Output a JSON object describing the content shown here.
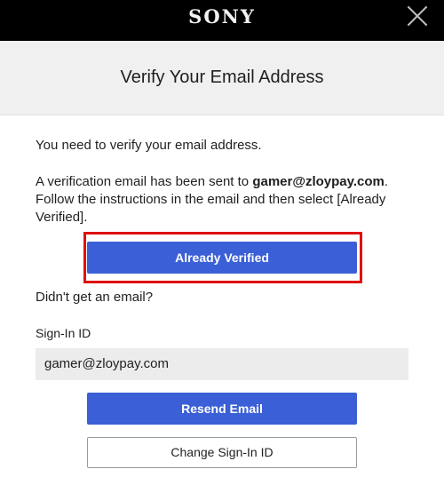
{
  "header": {
    "logo": "SONY",
    "close_icon": "close-icon"
  },
  "title": "Verify Your Email Address",
  "body": {
    "line1": "You need to verify your email address.",
    "line2_prefix": "A verification email has been sent to ",
    "email": "gamer@zloypay.com",
    "line2_suffix": ". Follow the instructions in the email and then select [Already Verified].",
    "no_email_prompt": "Didn't get an email?"
  },
  "buttons": {
    "already_verified": "Already Verified",
    "resend_email": "Resend Email",
    "change_signin_id": "Change Sign-In ID"
  },
  "signin": {
    "label": "Sign-In ID",
    "value": "gamer@zloypay.com"
  },
  "colors": {
    "primary_button": "#3a5fd6",
    "highlight_border": "#e01010",
    "topbar": "#000000"
  }
}
